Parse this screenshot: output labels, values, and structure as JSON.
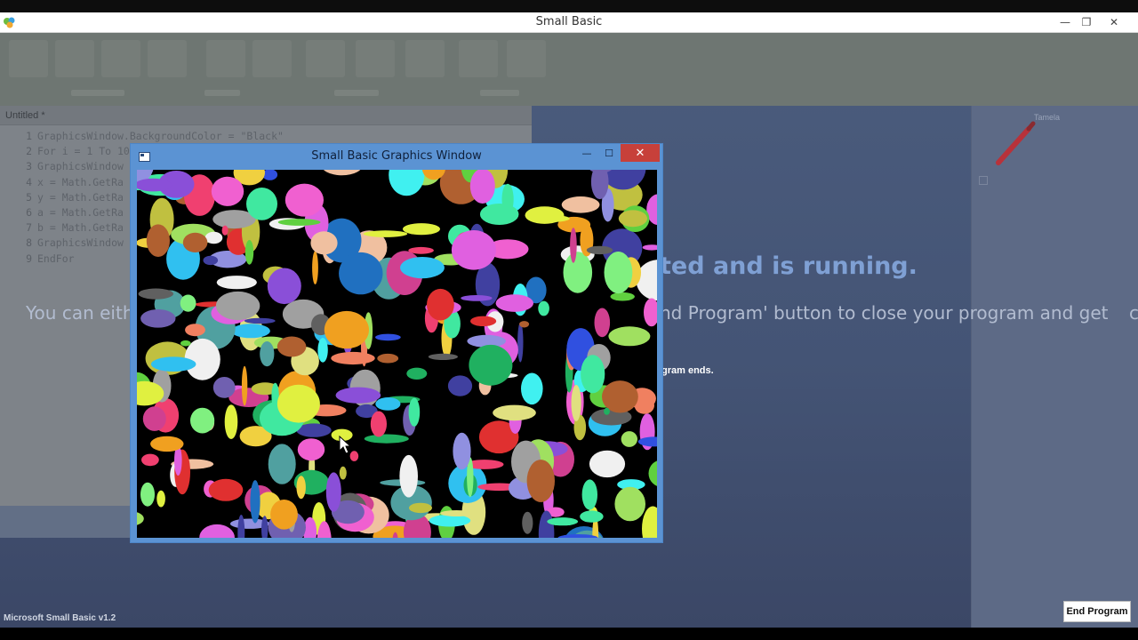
{
  "window": {
    "title": "Small Basic",
    "minimize": "—",
    "restore": "❐",
    "close": "✕"
  },
  "editor": {
    "tab_label": "Untitled *",
    "lines": [
      {
        "num": "1",
        "code": "GraphicsWindow.BackgroundColor = \"Black\""
      },
      {
        "num": "2",
        "code": "For i = 1 To 10"
      },
      {
        "num": "3",
        "code": "GraphicsWindow"
      },
      {
        "num": "4",
        "code": "x = Math.GetRa"
      },
      {
        "num": "5",
        "code": "y = Math.GetRa"
      },
      {
        "num": "6",
        "code": "a = Math.GetRa"
      },
      {
        "num": "7",
        "code": "b = Math.GetRa"
      },
      {
        "num": "8",
        "code": "GraphicsWindow"
      },
      {
        "num": "9",
        "code": "EndFor"
      }
    ]
  },
  "right_panel": {
    "label": "Tamela"
  },
  "overlay": {
    "headline": "ted and is running.",
    "subline_left": "You can eith",
    "subline_right": "nd Program' button to close your program and get",
    "edge_char": "c",
    "note": "gram ends."
  },
  "status_text": "Microsoft Small Basic v1.2",
  "end_program_label": "End Program",
  "graphics_window": {
    "title": "Small Basic Graphics Window",
    "minimize": "—",
    "maximize": "☐",
    "close": "✕",
    "background_color": "Black"
  },
  "colors": {
    "accent_blue": "#5b93d3",
    "headline": "#7fa0d4",
    "close_red": "#c7403a"
  }
}
